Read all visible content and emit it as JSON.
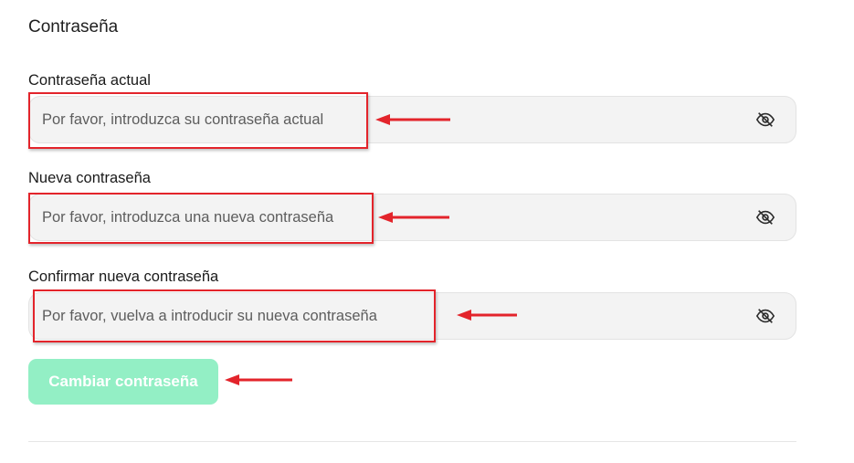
{
  "section": {
    "title": "Contraseña"
  },
  "fields": [
    {
      "label": "Contraseña actual",
      "placeholder": "Por favor, introduzca su contraseña actual",
      "toggle_icon": "eye-off-icon"
    },
    {
      "label": "Nueva contraseña",
      "placeholder": "Por favor, introduzca una nueva contraseña",
      "toggle_icon": "eye-off-icon"
    },
    {
      "label": "Confirmar nueva contraseña",
      "placeholder": "Por favor, vuelva a introducir su nueva contraseña",
      "toggle_icon": "eye-off-icon"
    }
  ],
  "submit": {
    "label": "Cambiar contraseña",
    "state": "disabled"
  },
  "colors": {
    "accent": "#93efc5",
    "highlight": "#e3242b",
    "input_bg": "#f3f3f3"
  }
}
